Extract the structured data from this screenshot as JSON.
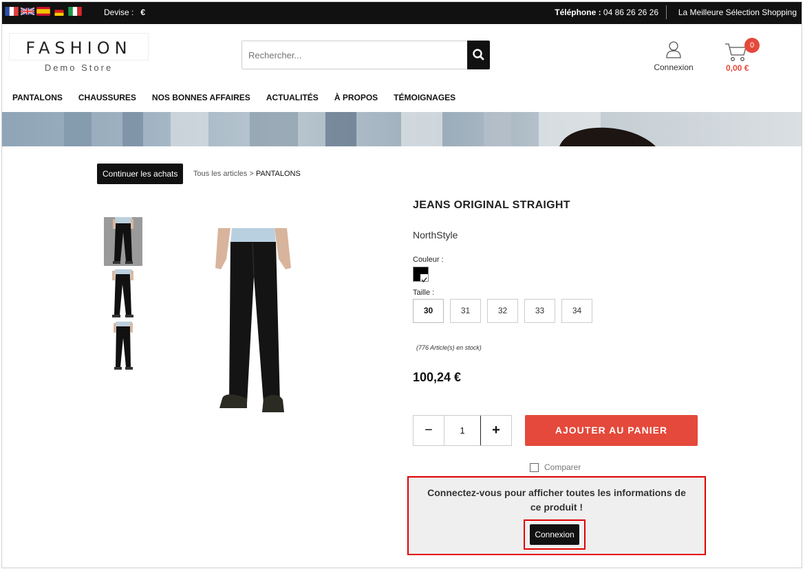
{
  "topbar": {
    "flags": [
      "fr-flag-icon",
      "gb-flag-icon",
      "es-flag-icon",
      "de-flag-icon",
      "it-flag-icon"
    ],
    "devise_label": "Devise :",
    "devise_value": "€",
    "phone_label": "Téléphone :",
    "phone_value": " 04 86 26 26 26",
    "slogan": "La Meilleure Sélection Shopping"
  },
  "header": {
    "logo_line1": "FASHION",
    "logo_line2": "Demo Store",
    "search_placeholder": "Rechercher...",
    "account_label": "Connexion",
    "cart_count": "0",
    "cart_total": "0,00 €"
  },
  "nav": {
    "items": [
      "PANTALONS",
      "CHAUSSURES",
      "NOS BONNES AFFAIRES",
      "ACTUALITÉS",
      "À PROPOS",
      "TÉMOIGNAGES"
    ]
  },
  "content": {
    "continue_label": "Continuer les achats",
    "breadcrumb_root": "Tous les articles",
    "breadcrumb_sep": ">",
    "breadcrumb_current": "PANTALONS"
  },
  "product": {
    "title": "JEANS ORIGINAL STRAIGHT",
    "brand": "NorthStyle",
    "color_label": "Couleur :",
    "size_label": "Taille :",
    "sizes": [
      "30",
      "31",
      "32",
      "33",
      "34"
    ],
    "selected_size": "30",
    "stock": "(776 Article(s) en stock)",
    "price": "100,24 €",
    "quantity": "1",
    "qty_minus": "−",
    "qty_plus": "+",
    "add_to_cart": "AJOUTER AU PANIER",
    "compare_label": "Comparer"
  },
  "login_prompt": {
    "message": "Connectez-vous pour afficher toutes les informations de ce produit !",
    "button": "Connexion"
  },
  "colors": {
    "accent": "#e4493b",
    "dark": "#111111",
    "highlight_border": "#e00000"
  }
}
